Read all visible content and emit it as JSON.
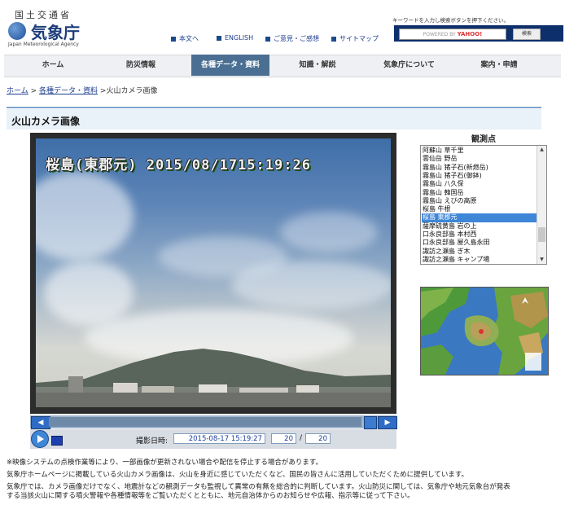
{
  "header": {
    "ministry": "国土交通省",
    "agency": "気象庁",
    "agency_en": "Japan Meteorological Agency",
    "links": [
      "本文へ",
      "ENGLISH",
      "ご意見・ご感想",
      "サイトマップ"
    ],
    "search": {
      "hint": "キーワードを入力し検索ボタンを押下ください。",
      "powered_by": "POWERED BY",
      "yahoo": "YAHOO!",
      "button": "検索"
    }
  },
  "nav": {
    "items": [
      "ホーム",
      "防災情報",
      "各種データ・資料",
      "知識・解説",
      "気象庁について",
      "案内・申請"
    ],
    "active": "各種データ・資料"
  },
  "breadcrumb": {
    "home": "ホーム",
    "sep1": ">",
    "data": "各種データ・資料",
    "sep2": ">",
    "current": "火山カメラ画像"
  },
  "page_title": "火山カメラ画像",
  "camera": {
    "stamp": "桜島(東郡元) 2015/08/1715:19:26",
    "shot_label": "撮影日時:",
    "datetime": "2015-08-17 15:19:27",
    "frame": "20",
    "total": "20",
    "slash": "/"
  },
  "sidebar": {
    "heading": "観測点",
    "selected": "桜島 東郡元",
    "stations": [
      "阿蘇山 草千里",
      "雲仙岳 野岳",
      "霧島山 猪子石(新燃岳)",
      "霧島山 猪子石(御鉢)",
      "霧島山 八久保",
      "霧島山 韓国岳",
      "霧島山 えびの高原",
      "桜島 牛根",
      "桜島 東郡元",
      "薩摩硫黄島 岩の上",
      "口永良部島 本村西",
      "口永良部島 屋久島永田",
      "諏訪之瀬島 ぎ木",
      "諏訪之瀬島 キャンプ場"
    ]
  },
  "notes": [
    "※映像システムの点検作業等により、一部画像が更新されない場合や配信を停止する場合があります。",
    "気象庁ホームページに掲載している火山カメラ画像は、火山を身近に感じていただくなど、国民の皆さんに活用していただくために提供しています。",
    "気象庁では、カメラ画像だけでなく、地震計などの観測データも監視して異常の有無を総合的に判断しています。火山防災に関しては、気象庁や地元気象台が発表",
    "する当該火山に関する噴火警報や各種情報等をご覧いただくとともに、地元自治体からのお知らせや広報、指示等に従って下さい。"
  ]
}
